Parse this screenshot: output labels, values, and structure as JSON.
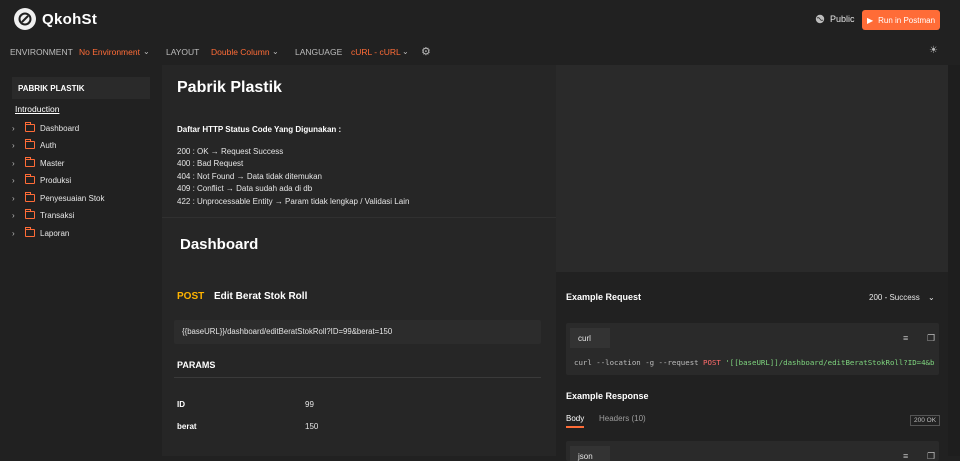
{
  "header": {
    "brand": "QkohSt",
    "visibility": "Public",
    "run_button": "Run in Postman"
  },
  "envbar": {
    "environment_label": "ENVIRONMENT",
    "environment_value": "No Environment",
    "layout_label": "LAYOUT",
    "layout_value": "Double Column",
    "language_label": "LANGUAGE",
    "language_value": "cURL - cURL"
  },
  "sidebar": {
    "title": "PABRIK PLASTIK",
    "intro": "Introduction",
    "items": [
      {
        "label": "Dashboard"
      },
      {
        "label": "Auth"
      },
      {
        "label": "Master"
      },
      {
        "label": "Produksi"
      },
      {
        "label": "Penyesuaian Stok"
      },
      {
        "label": "Transaksi"
      },
      {
        "label": "Laporan"
      }
    ]
  },
  "main": {
    "title": "Pabrik Plastik",
    "desc_heading": "Daftar HTTP Status Code Yang Digunakan :",
    "desc_lines": [
      "200 : OK → Request Success",
      "400 : Bad Request",
      "404 : Not Found → Data tidak ditemukan",
      "409 : Conflict → Data sudah ada di db",
      "422 : Unprocessable Entity → Param tidak lengkap / Validasi Lain"
    ],
    "folder_title": "Dashboard",
    "endpoint": {
      "method": "POST",
      "name": "Edit Berat Stok Roll",
      "url": "{{baseURL}}/dashboard/editBeratStokRoll?ID=99&berat=150",
      "params_heading": "PARAMS",
      "params": [
        {
          "key": "ID",
          "value": "99"
        },
        {
          "key": "berat",
          "value": "150"
        }
      ]
    }
  },
  "example": {
    "request_heading": "Example Request",
    "selected_example": "200 - Success",
    "code_tab": "curl",
    "code_prefix": "curl --location -g --request ",
    "code_method": "POST",
    "code_url": "'[[baseURL]]/dashboard/editBeratStokRoll?ID=4&b",
    "response_heading": "Example Response",
    "tab_body": "Body",
    "tab_headers": "Headers (10)",
    "status_badge": "200 OK",
    "response_tab": "json"
  }
}
